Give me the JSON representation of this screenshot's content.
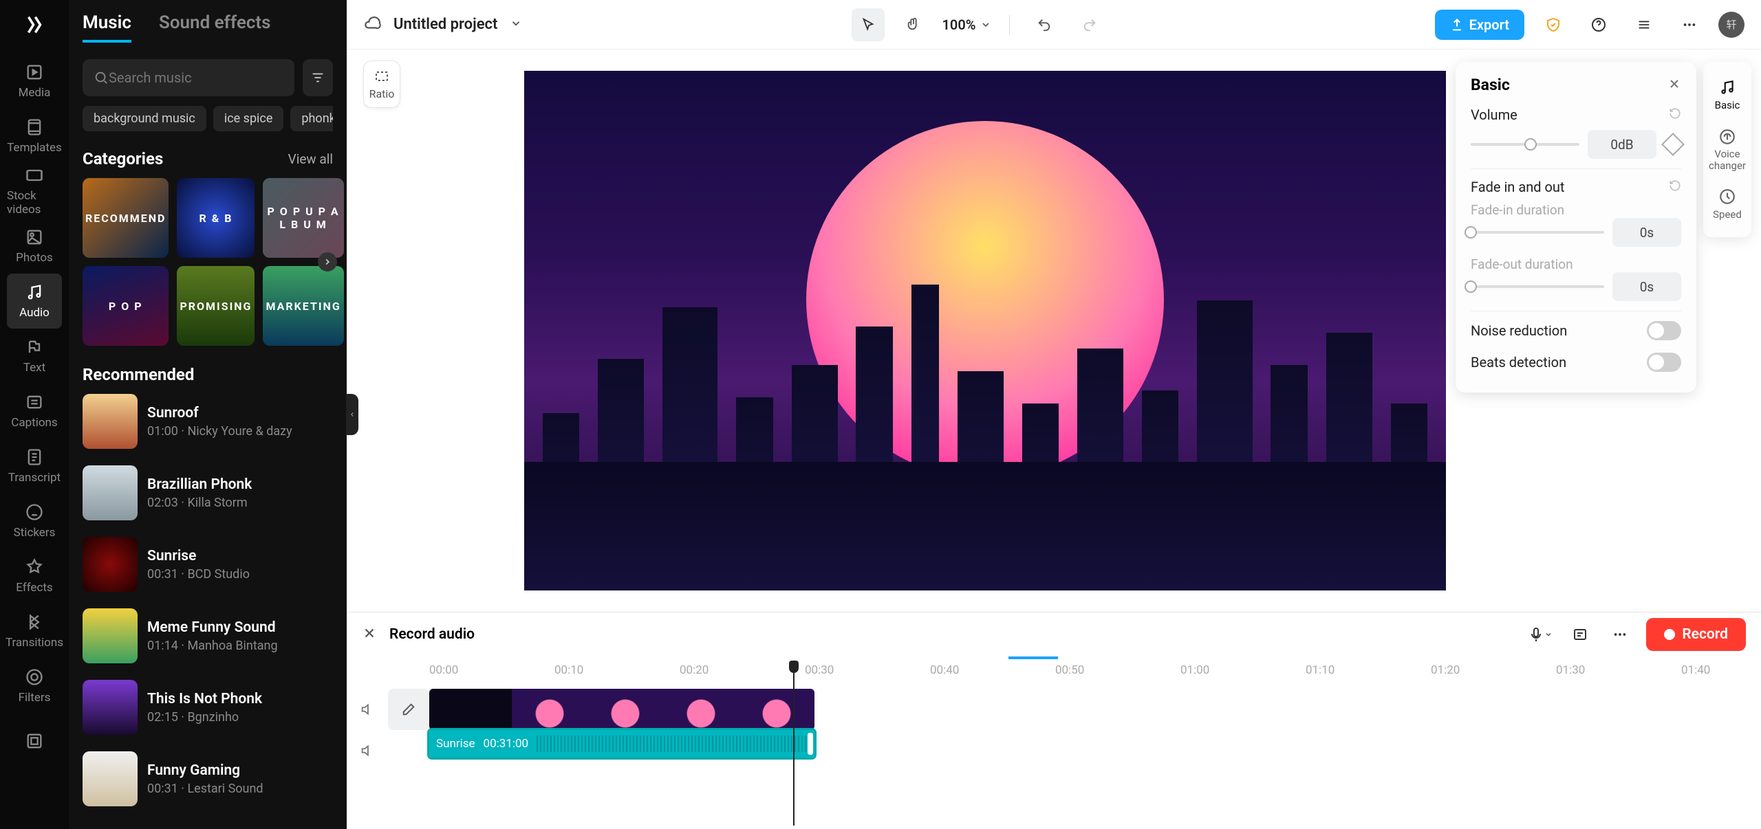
{
  "rail": {
    "items": [
      {
        "label": "Media"
      },
      {
        "label": "Templates"
      },
      {
        "label": "Stock videos"
      },
      {
        "label": "Photos"
      },
      {
        "label": "Audio"
      },
      {
        "label": "Text"
      },
      {
        "label": "Captions"
      },
      {
        "label": "Transcript"
      },
      {
        "label": "Stickers"
      },
      {
        "label": "Effects"
      },
      {
        "label": "Transitions"
      },
      {
        "label": "Filters"
      }
    ]
  },
  "library": {
    "tabs": {
      "music": "Music",
      "sfx": "Sound effects"
    },
    "search_placeholder": "Search music",
    "chips": [
      "background music",
      "ice spice",
      "phonk"
    ],
    "categories_label": "Categories",
    "view_all": "View all",
    "categories": [
      {
        "label": "RECOMMEND",
        "bg": "linear-gradient(135deg,#b86a1a,#0a254a)"
      },
      {
        "label": "R & B",
        "bg": "radial-gradient(circle,#2a4bd0,#07103a)"
      },
      {
        "label": "P O P U P  A L B U M",
        "bg": "linear-gradient(135deg,#4a5b60,#6a4656)"
      },
      {
        "label": "P O P",
        "bg": "linear-gradient(160deg,#0a1a60,#5a0a30)"
      },
      {
        "label": "PROMISING",
        "bg": "linear-gradient(#5a7a20,#1a3a0a)"
      },
      {
        "label": "MARKETING",
        "bg": "linear-gradient(#3aa060,#0a3a5a)"
      }
    ],
    "recommended_label": "Recommended",
    "tracks": [
      {
        "title": "Sunroof",
        "meta": "01:00 · Nicky Youre & dazy",
        "bg": "linear-gradient(#f2d090,#b05030)"
      },
      {
        "title": "Brazillian Phonk",
        "meta": "02:03 · Killa Storm",
        "bg": "linear-gradient(#d0dae0,#8a98a0)"
      },
      {
        "title": "Sunrise",
        "meta": "00:31 · BCD Studio",
        "bg": "radial-gradient(circle,#8a0a0a,#200000)"
      },
      {
        "title": "Meme Funny Sound",
        "meta": "01:14 · Manhoa Bintang",
        "bg": "linear-gradient(#f2d040,#3aa060)"
      },
      {
        "title": "This Is Not Phonk",
        "meta": "02:15 · Bgnzinho",
        "bg": "linear-gradient(#7a3ad0,#1a0a30)"
      },
      {
        "title": "Funny Gaming",
        "meta": "00:31 · Lestari Sound",
        "bg": "linear-gradient(#f0f0f0,#d0c0a0)"
      }
    ]
  },
  "topbar": {
    "project_name": "Untitled project",
    "zoom": "100%",
    "export": "Export",
    "avatar": "轩"
  },
  "ratio_label": "Ratio",
  "right_rail": {
    "basic": "Basic",
    "voice": "Voice changer",
    "speed": "Speed"
  },
  "basic_panel": {
    "title": "Basic",
    "volume_label": "Volume",
    "volume_value": "0dB",
    "fade_label": "Fade in and out",
    "fade_in_label": "Fade-in duration",
    "fade_in_value": "0s",
    "fade_out_label": "Fade-out duration",
    "fade_out_value": "0s",
    "noise_label": "Noise reduction",
    "beats_label": "Beats detection"
  },
  "timeline": {
    "title": "Record audio",
    "record": "Record",
    "ruler": [
      "00:00",
      "00:10",
      "00:20",
      "00:30",
      "00:40",
      "00:50",
      "01:00",
      "01:10",
      "01:20",
      "01:30",
      "01:40"
    ],
    "audio_clip_name": "Sunrise",
    "audio_clip_time": "00:31:00"
  }
}
